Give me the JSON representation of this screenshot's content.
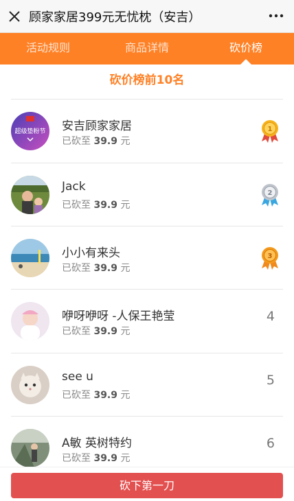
{
  "window": {
    "title": "顾家家居399元无忧枕（安吉）"
  },
  "tabs": [
    {
      "label": "活动规则",
      "active": false
    },
    {
      "label": "商品详情",
      "active": false
    },
    {
      "label": "砍价榜",
      "active": true
    }
  ],
  "ranking": {
    "title": "砍价榜前10名",
    "cut_prefix": "已砍至",
    "cut_unit": "元",
    "entries": [
      {
        "name": "安吉顾家家居",
        "price": "39.9",
        "rank": "1",
        "medal": "gold",
        "avatar_text": "超级垫粉节"
      },
      {
        "name": "Jack",
        "price": "39.9",
        "rank": "2",
        "medal": "silver"
      },
      {
        "name": "小小有来头",
        "price": "39.9",
        "rank": "3",
        "medal": "bronze"
      },
      {
        "name": "咿呀咿呀 -人保王艳莹",
        "price": "39.9",
        "rank": "4"
      },
      {
        "name": "see u",
        "price": "39.9",
        "rank": "5"
      },
      {
        "name": "A敏 英树特约",
        "price": "39.9",
        "rank": "6"
      }
    ]
  },
  "cta": {
    "label": "砍下第一刀"
  },
  "colors": {
    "accent": "#ff8126",
    "cta": "#e35050",
    "gold": "#f5b21c",
    "silver": "#bfc4cc",
    "bronze": "#f39a1e"
  }
}
